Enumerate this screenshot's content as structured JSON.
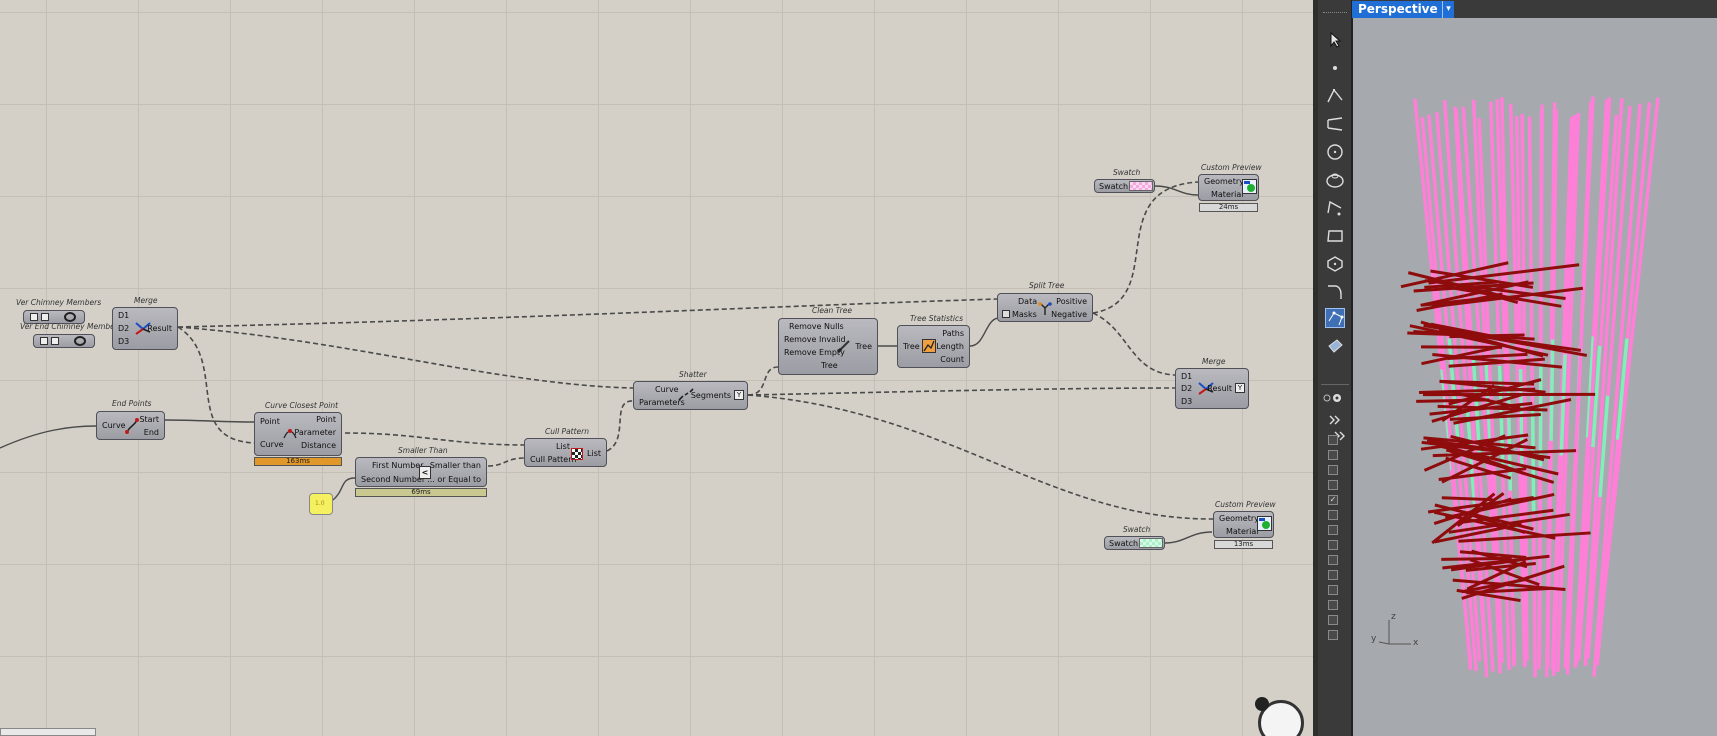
{
  "nodes": {
    "ver_chimney_members": "Ver Chimney Members",
    "ver_end_chimney_members": "Ver End Chimney Members",
    "merge_a": {
      "title": "Merge",
      "d1": "D1",
      "d2": "D2",
      "d3": "D3",
      "result": "Result"
    },
    "end_points": {
      "title": "End Points",
      "curve": "Curve",
      "start": "Start",
      "end": "End"
    },
    "curve_closest_point": {
      "title": "Curve Closest Point",
      "point": "Point",
      "curve": "Curve",
      "point_out": "Point",
      "parameter": "Parameter",
      "distance": "Distance",
      "timing": "163ms"
    },
    "smaller_than": {
      "title": "Smaller Than",
      "first_number": "First Number",
      "second_number": "Second Number",
      "op": "<",
      "smaller_than": "Smaller than",
      "or_equal": "... or Equal to",
      "timing": "69ms"
    },
    "number_slider": "1.0",
    "cull_pattern": {
      "title": "Cull Pattern",
      "list": "List",
      "cull_pattern": "Cull Pattern",
      "list_out": "List"
    },
    "shatter": {
      "title": "Shatter",
      "curve": "Curve",
      "parameters": "Parameters",
      "segments": "Segments"
    },
    "clean_tree": {
      "title": "Clean Tree",
      "remove_nulls": "Remove Nulls",
      "remove_invalid": "Remove Invalid",
      "remove_empty": "Remove Empty",
      "tree": "Tree",
      "tree_out": "Tree"
    },
    "tree_statistics": {
      "title": "Tree Statistics",
      "tree": "Tree",
      "paths": "Paths",
      "length": "Length",
      "count": "Count"
    },
    "split_tree": {
      "title": "Split Tree",
      "data": "Data",
      "masks": "Masks",
      "positive": "Positive",
      "negative": "Negative"
    },
    "merge_b": {
      "title": "Merge",
      "d1": "D1",
      "d2": "D2",
      "d3": "D3",
      "result": "Result"
    },
    "swatch_top": {
      "title": "Swatch",
      "label": "Swatch",
      "color": "#f4a8e0"
    },
    "custom_preview_top": {
      "title": "Custom Preview",
      "geometry": "Geometry",
      "material": "Material",
      "timing": "24ms"
    },
    "swatch_bottom": {
      "title": "Swatch",
      "label": "Swatch",
      "color": "#a8f0c8"
    },
    "custom_preview_bottom": {
      "title": "Custom Preview",
      "geometry": "Geometry",
      "material": "Material",
      "timing": "13ms"
    }
  },
  "viewport": {
    "name": "Perspective",
    "dropdown": "▾",
    "axis_z": "z",
    "axis_y": "y",
    "axis_x": "x"
  },
  "colors": {
    "canvas": "#d4d0c8",
    "pink": "#ff7fd8",
    "green": "#7ff0b8",
    "red": "#8e0c0c",
    "timing_orange": "#e0982a",
    "timing_olive": "#c8c890"
  }
}
